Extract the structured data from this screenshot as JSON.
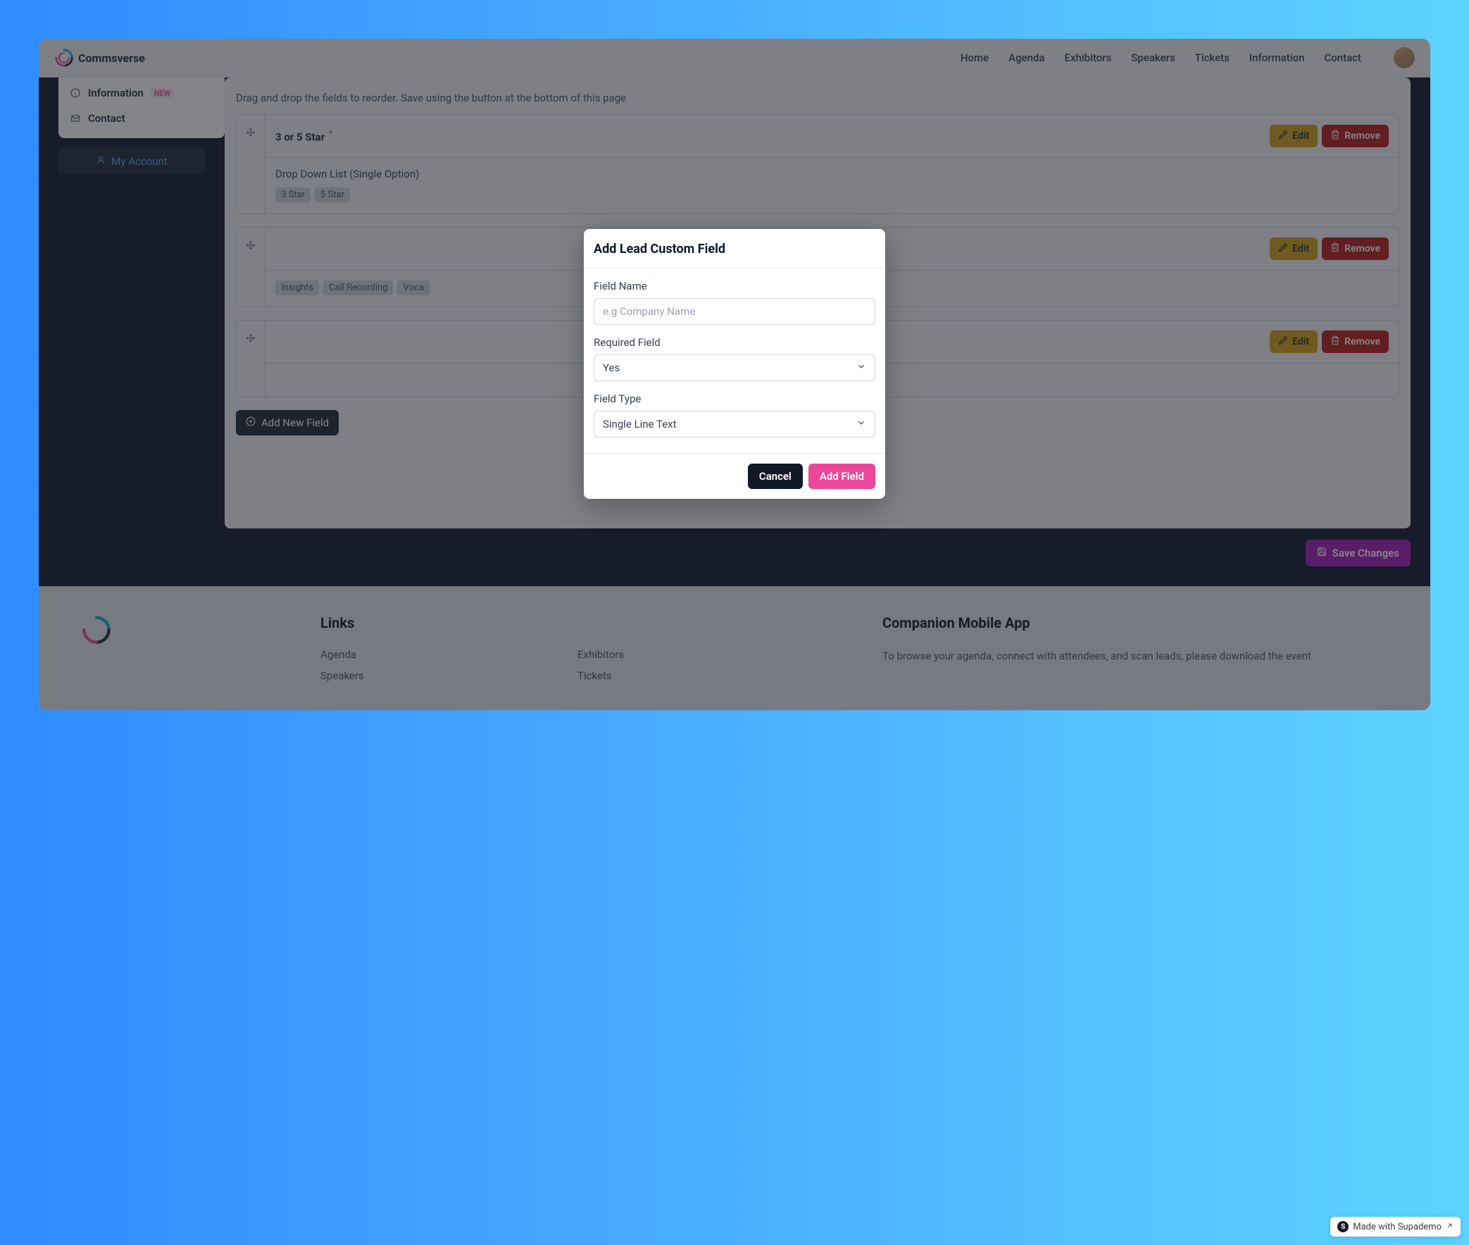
{
  "logo_text": "Commsverse",
  "nav": [
    "Home",
    "Agenda",
    "Exhibitors",
    "Speakers",
    "Tickets",
    "Information",
    "Contact"
  ],
  "sidebar": {
    "items": [
      {
        "label": "Information",
        "badge": "NEW"
      },
      {
        "label": "Contact"
      }
    ],
    "my_account": "My Account"
  },
  "content": {
    "desc": "Drag and drop the fields to reorder. Save using the button at the bottom of this page",
    "fields": [
      {
        "title": "3 or 5 Star",
        "required": true,
        "type_label": "Drop Down List (Single Option)",
        "tags": [
          "3 Star",
          "5 Star"
        ]
      },
      {
        "title": "",
        "required": false,
        "type_label": "",
        "tags": [
          "Insights",
          "Call Recording",
          "Voca"
        ]
      },
      {
        "title": "",
        "required": false,
        "type_label": "",
        "tags": []
      }
    ],
    "edit_label": "Edit",
    "remove_label": "Remove",
    "add_new_field": "Add New Field",
    "save_changes": "Save Changes"
  },
  "modal": {
    "title": "Add Lead Custom Field",
    "field_name_label": "Field Name",
    "field_name_placeholder": "e.g Company Name",
    "required_label": "Required Field",
    "required_value": "Yes",
    "type_label": "Field Type",
    "type_value": "Single Line Text",
    "cancel": "Cancel",
    "add": "Add Field"
  },
  "footer": {
    "links_heading": "Links",
    "links": [
      "Agenda",
      "Exhibitors",
      "Speakers",
      "Tickets"
    ],
    "app_heading": "Companion Mobile App",
    "app_text": "To browse your agenda, connect with attendees, and scan leads, please download the event"
  },
  "supademo": "Made with Supademo"
}
